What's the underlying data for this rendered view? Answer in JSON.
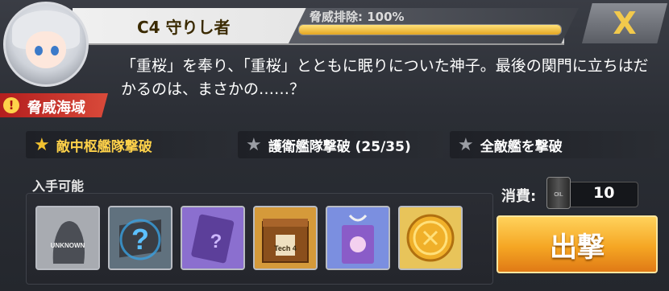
{
  "stage": {
    "code": "C4",
    "name": "守りし者"
  },
  "threat": {
    "label": "脅威排除: 100%",
    "progress": 1.0
  },
  "close_button": "X",
  "description": "「重桜」を奉り、「重桜」とともに眠りについた神子。最後の関門に立ちはだかるのは、まさかの……？",
  "zone_badge": {
    "icon": "!",
    "label": "脅威海域"
  },
  "objectives": [
    {
      "label": "敵中枢艦隊撃破",
      "achieved": true
    },
    {
      "label": "護衛艦隊撃破 (25/35)",
      "achieved": false
    },
    {
      "label": "全敵艦を撃破",
      "achieved": false
    }
  ],
  "drops": {
    "section_label": "入手可能",
    "items": [
      {
        "name": "unknown-item",
        "label": "UNKNOWN",
        "icon": "silhouette"
      },
      {
        "name": "random-box",
        "label": "?",
        "icon": "question-box"
      },
      {
        "name": "mystery-card",
        "label": "?",
        "icon": "purple-card"
      },
      {
        "name": "tech-box-t4",
        "label": "Tech 4",
        "icon": "crate"
      },
      {
        "name": "sakura-charm",
        "label": "",
        "icon": "omamori"
      },
      {
        "name": "coin",
        "label": "",
        "icon": "gold-coin"
      }
    ]
  },
  "cost": {
    "label": "消費:",
    "value": "10",
    "icon": "oil-barrel",
    "barrel_text": "OIL"
  },
  "sortie_button": "出撃",
  "colors": {
    "gold": "#f5a623",
    "star_active": "#f2c230",
    "star_inactive": "#9a9da4"
  }
}
